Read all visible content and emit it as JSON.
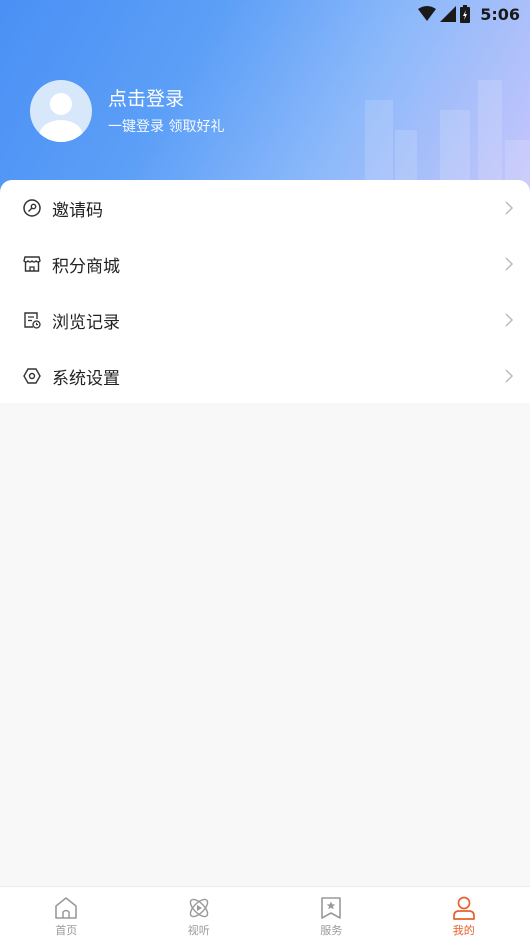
{
  "status_bar": {
    "time": "5:06"
  },
  "profile": {
    "title": "点击登录",
    "subtitle": "一键登录  领取好礼"
  },
  "menu": [
    {
      "label": "邀请码",
      "icon": "key-icon"
    },
    {
      "label": "积分商城",
      "icon": "shop-icon"
    },
    {
      "label": "浏览记录",
      "icon": "history-icon"
    },
    {
      "label": "系统设置",
      "icon": "settings-icon"
    }
  ],
  "tabs": [
    {
      "label": "首页",
      "icon": "home-icon",
      "active": false
    },
    {
      "label": "视听",
      "icon": "media-icon",
      "active": false
    },
    {
      "label": "服务",
      "icon": "service-icon",
      "active": false
    },
    {
      "label": "我的",
      "icon": "user-icon",
      "active": true
    }
  ],
  "colors": {
    "accent": "#e8602c",
    "header_start": "#4a90f5",
    "header_end": "#c8c6fb"
  }
}
